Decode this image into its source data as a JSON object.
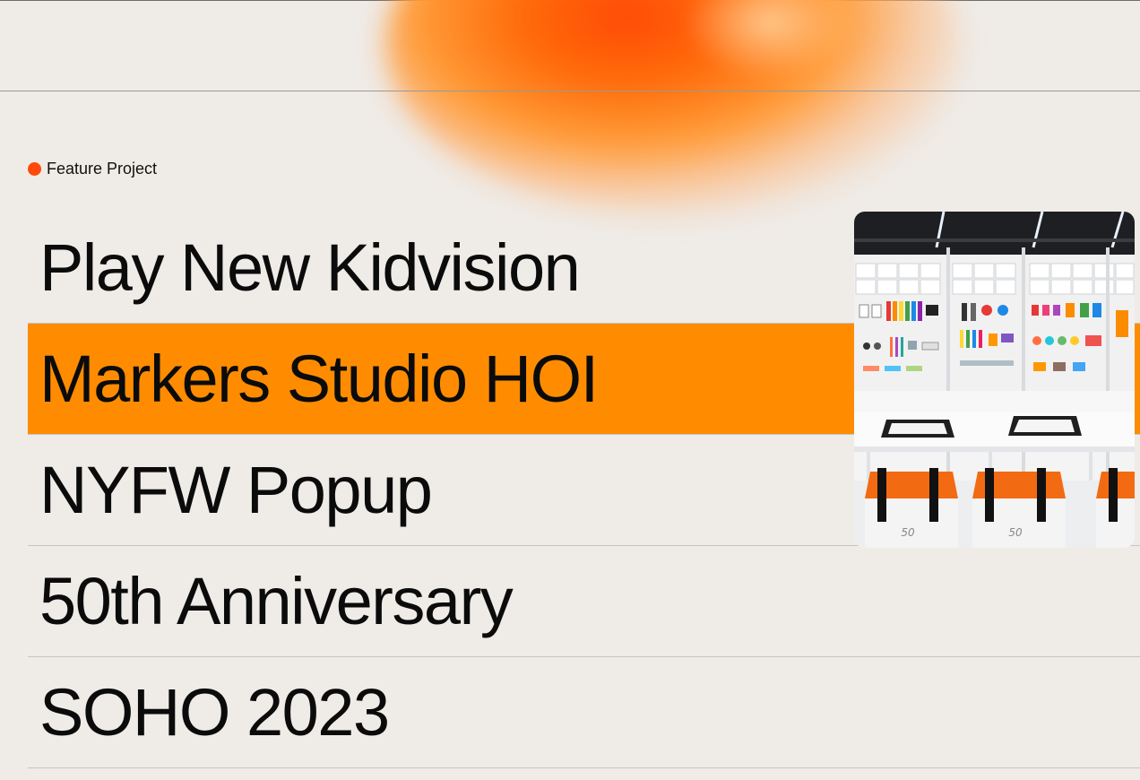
{
  "section": {
    "label": "Feature Project",
    "accent": "#ff4a0a"
  },
  "projects": [
    {
      "title": "Play New Kidvision",
      "active": false
    },
    {
      "title": "Markers Studio HOI",
      "active": true
    },
    {
      "title": "NYFW Popup",
      "active": false
    },
    {
      "title": "50th Anniversary",
      "active": false
    },
    {
      "title": "SOHO 2023",
      "active": false
    }
  ],
  "highlight_color": "#ff8c00",
  "preview": {
    "alt": "Markers Studio HOI store interior",
    "box_marks": [
      "50",
      "50"
    ]
  }
}
